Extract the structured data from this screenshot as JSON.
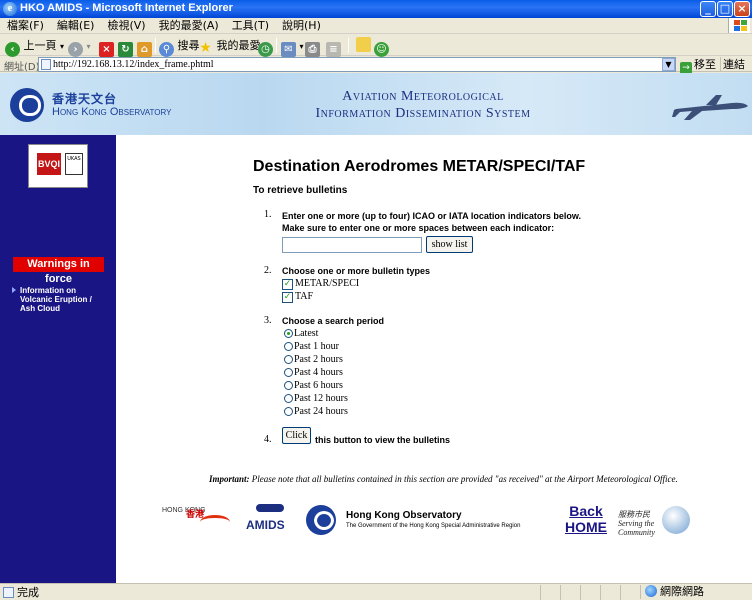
{
  "window": {
    "title": "HKO AMIDS - Microsoft Internet Explorer",
    "minimize": "_",
    "maximize": "□",
    "close": "×"
  },
  "menu": [
    "檔案(F)",
    "編輯(E)",
    "檢視(V)",
    "我的最愛(A)",
    "工具(T)",
    "說明(H)"
  ],
  "toolbar": {
    "back_label": "上一頁",
    "search_label": "搜尋",
    "favorites_label": "我的最愛"
  },
  "address": {
    "label": "網址(D)",
    "url": "http://192.168.13.12/index_frame.phtml",
    "go_label": "移至",
    "links_label": "連結"
  },
  "banner": {
    "hko_cn": "香港天文台",
    "hko_en": "Hong Kong Observatory",
    "system_line1": "Aviation Meteorological",
    "system_line2": "Information Dissemination System"
  },
  "leftnav": {
    "cert_mark": "BVQI",
    "accreditation_mark": "UKAS",
    "warnings_label": "Warnings in force",
    "info_link": "Information on Volcanic Eruption / Ash Cloud"
  },
  "main": {
    "heading": "Destination Aerodromes METAR/SPECI/TAF",
    "retrieve": "To retrieve bulletins",
    "step1": {
      "num": "1.",
      "line1": "Enter one or more (up to four) ICAO or IATA location indicators below.",
      "line2": "Make sure to enter one or more spaces between each indicator:",
      "input_value": "",
      "show_list_label": "show list"
    },
    "step2": {
      "num": "2.",
      "title": "Choose one or more bulletin types",
      "options": [
        {
          "label": "METAR/SPECI",
          "checked": true
        },
        {
          "label": "TAF",
          "checked": true
        }
      ]
    },
    "step3": {
      "num": "3.",
      "title": "Choose a search period",
      "options": [
        "Latest",
        "Past 1 hour",
        "Past 2 hours",
        "Past 4 hours",
        "Past 6 hours",
        "Past 12 hours",
        "Past 24 hours"
      ],
      "selected": "Latest"
    },
    "step4": {
      "num": "4.",
      "button_label": "Click",
      "text": "this button to view the bulletins"
    },
    "important_label": "Important:",
    "important_text": " Please note that all bulletins contained in this section are provided \"as received\" at the Airport Meteorological Office."
  },
  "footer": {
    "hk_brand_en": "HONG KONG",
    "hk_brand_cn": "香港",
    "amids": "AMIDS",
    "hko_name": "Hong Kong Observatory",
    "hko_sub": "The Government of the Hong Kong Special Administrative Region",
    "back": "Back",
    "home": "HOME",
    "serving_cn": "服務市民",
    "serving_en": "Serving the Community"
  },
  "status": {
    "text": "完成",
    "zone": "網際網路"
  }
}
